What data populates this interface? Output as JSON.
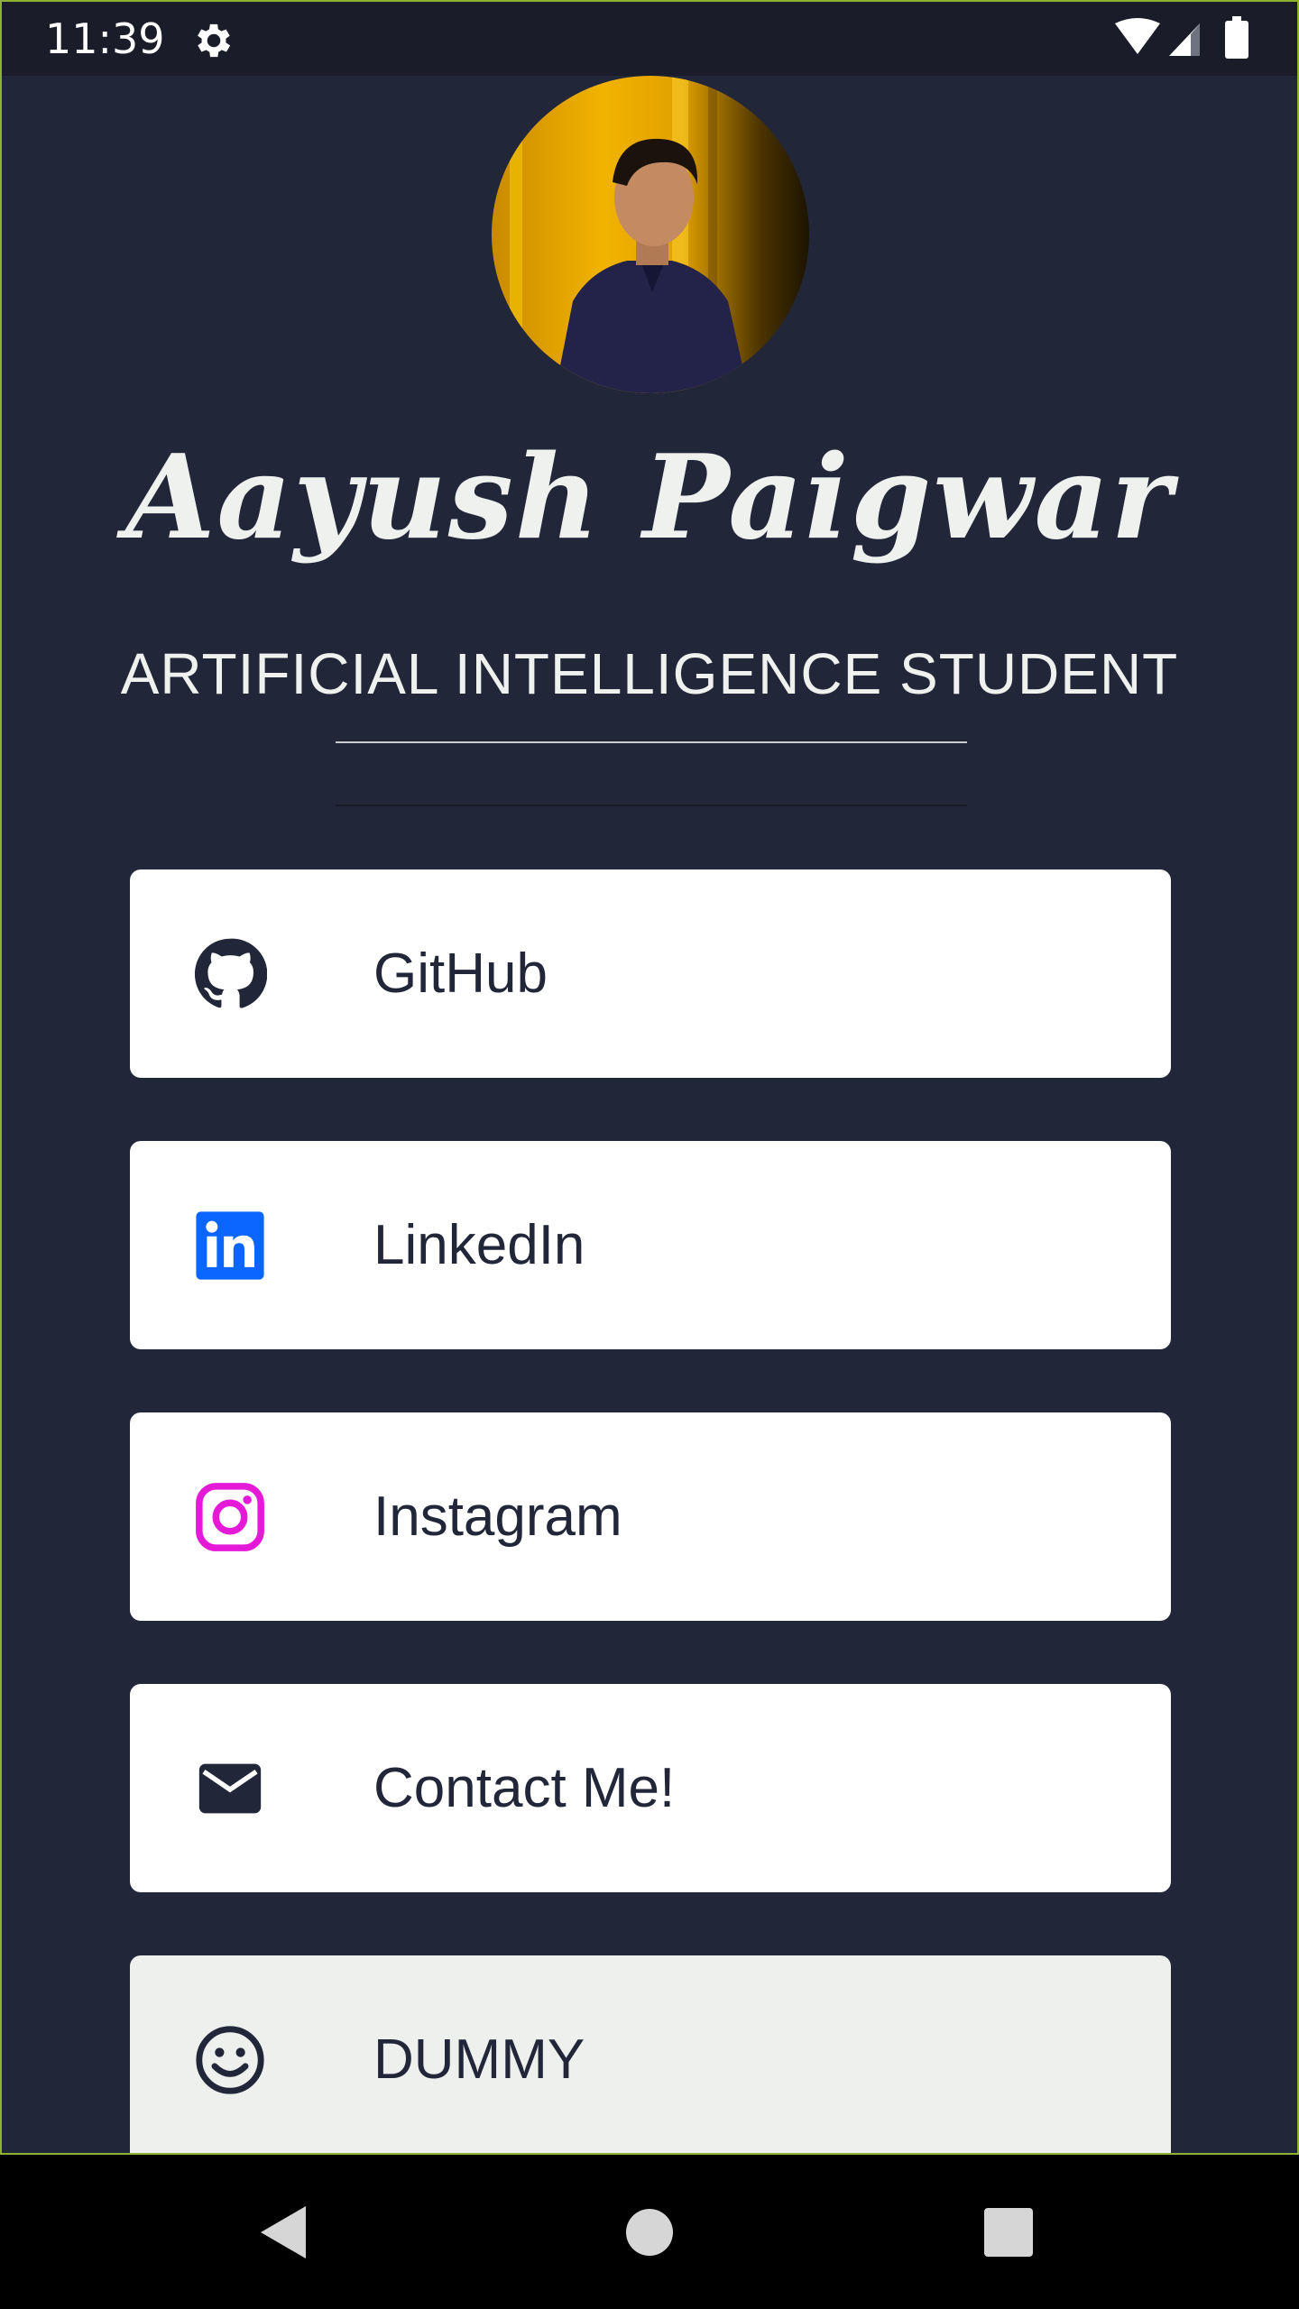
{
  "status_bar": {
    "time": "11:39",
    "settings_icon": "gear-icon",
    "wifi_icon": "wifi-icon",
    "signal_icon": "cell-signal-icon",
    "battery_icon": "battery-icon"
  },
  "profile": {
    "name": "Aayush Paigwar",
    "subtitle": "ARTIFICIAL INTELLIGENCE STUDENT"
  },
  "links": [
    {
      "label": "GitHub",
      "icon": "github-icon"
    },
    {
      "label": "LinkedIn",
      "icon": "linkedin-icon",
      "color": "#0a66c2"
    },
    {
      "label": "Instagram",
      "icon": "instagram-icon",
      "color": "#e51ad9"
    },
    {
      "label": "Contact Me!",
      "icon": "mail-icon"
    },
    {
      "label": "DUMMY",
      "icon": "smiley-icon"
    }
  ],
  "nav_bar": {
    "back_icon": "back-triangle-icon",
    "home_icon": "home-circle-icon",
    "recents_icon": "recents-square-icon"
  },
  "colors": {
    "background": "#222639",
    "card": "#ffffff",
    "text_dark": "#222639",
    "text_light": "#eef1ee"
  }
}
